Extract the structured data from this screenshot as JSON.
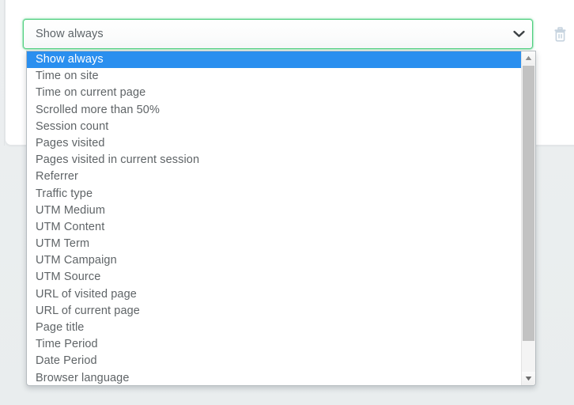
{
  "control": {
    "select": {
      "name": "trigger-condition-select",
      "value": "Show always",
      "placeholder": "Show always",
      "arrow_icon": "chevron-down-icon",
      "focused": true,
      "focus_color": "#4fd07f"
    },
    "delete_button": {
      "icon": "trash-icon",
      "label": "Delete",
      "color": "#c5d2de"
    }
  },
  "dropdown": {
    "expanded": true,
    "selected_index": 0,
    "highlight_color": "#2a8fef",
    "items": [
      "Show always",
      "Time on site",
      "Time on current page",
      "Scrolled more than 50%",
      "Session count",
      "Pages visited",
      "Pages visited in current session",
      "Referrer",
      "Traffic type",
      "UTM Medium",
      "UTM Content",
      "UTM Term",
      "UTM Campaign",
      "UTM Source",
      "URL of visited page",
      "URL of current page",
      "Page title",
      "Time Period",
      "Date Period",
      "Browser language"
    ],
    "scrollbar": {
      "up_arrow_icon": "triangle-up-icon",
      "down_arrow_icon": "triangle-down-icon",
      "thumb_name": "scrollbar-thumb"
    }
  }
}
